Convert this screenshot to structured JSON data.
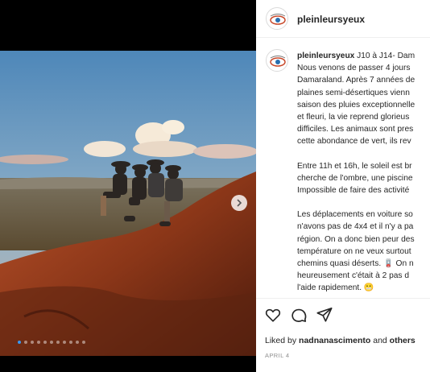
{
  "post": {
    "username": "pleinleursyeux",
    "image_carousel": {
      "slide_count": 11,
      "active_index": 0
    }
  },
  "caption": {
    "username": "pleinleursyeux",
    "lines": [
      " J10 à J14- Dam",
      "Nous venons de passer 4 jours",
      "Damaraland. Après 7 années de",
      "plaines semi-désertiques vienn",
      "saison des pluies exceptionnelle",
      "et fleuri, la vie reprend glorieus",
      "difficiles. Les animaux sont pres",
      "cette abondance de vert, ils rev",
      "",
      "Entre 11h et 16h, le soleil est br",
      "cherche de l'ombre, une piscine",
      "Impossible de faire des activité",
      "",
      "Les déplacements en voiture so",
      "n'avons pas de 4x4 et il n'y a pa",
      "région. On a donc bien peur des",
      "température on ne veux surtout",
      "chemins quasi déserts. 🪫 On n",
      "heureusement c'était à 2 pas d",
      "l'aide rapidement. 😬"
    ]
  },
  "likes": {
    "prefix": "Liked by ",
    "user": "nadnanascimento",
    "middle": " and ",
    "others": "others"
  },
  "date": "APRIL 4",
  "icons": [
    "heart-icon",
    "comment-icon",
    "share-icon",
    "chevron-right-icon"
  ],
  "colors": {
    "active_dot": "#3897f0",
    "text": "#262626",
    "muted": "#8e8e8e"
  }
}
